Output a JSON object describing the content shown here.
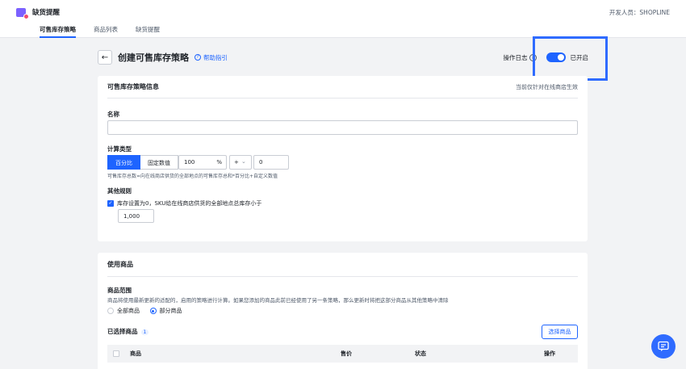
{
  "app": {
    "title": "缺货提醒",
    "developer": "开发人员：SHOPLINE"
  },
  "tabs": [
    "可售库存策略",
    "商品列表",
    "缺货提醒"
  ],
  "header": {
    "back_icon": "arrow-left-icon",
    "title": "创建可售库存策略",
    "help_label": "帮助指引",
    "log_label": "操作日志",
    "toggle_label": "已开启",
    "toggle_on": true
  },
  "section_info": {
    "title": "可售库存策略信息",
    "note": "当前仅针对在线商店生效",
    "name_label": "名称",
    "name_value": "",
    "calc_label": "计算类型",
    "calc_options": [
      "百分比",
      "固定数值"
    ],
    "calc_selected": "百分比",
    "percent_value": "100",
    "percent_unit": "%",
    "operator_value": "+",
    "extra_value": "0",
    "calc_hint": "可售库存总数=向在线商店供货的全部地点的可售库存总和*百分比+自定义数值",
    "rules_label": "其他规则",
    "rule_text": "库存设置为0，SKU给在线商店供货的全部地点总库存小于",
    "rule_checked": true,
    "rule_threshold": "1,000"
  },
  "section_products": {
    "title": "使用商品",
    "scope_label": "商品范围",
    "scope_desc": "商品将使用最新更新的适配的，启用的策略进行计算。如果您添加的商品此前已经使用了另一条策略，那么更新时将把这部分商品从其他策略中清除",
    "scope_options": [
      "全部商品",
      "部分商品"
    ],
    "scope_selected": "部分商品",
    "selected_label": "已选择商品",
    "selected_count": "1",
    "select_button": "选择商品",
    "table_headers": [
      "商品",
      "售价",
      "状态",
      "操作"
    ]
  },
  "colors": {
    "accent": "#1e64ff",
    "highlight": "#2f6bff",
    "background": "#f2f3f5"
  }
}
